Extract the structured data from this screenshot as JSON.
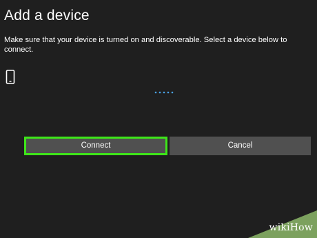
{
  "dialog": {
    "title": "Add a device",
    "description": "Make sure that your device is turned on and discoverable. Select a device below to connect.",
    "device_icon": "phone-icon",
    "spinner": "loading-dots"
  },
  "buttons": {
    "connect_label": "Connect",
    "cancel_label": "Cancel"
  },
  "watermark": {
    "text": "wikiHow"
  },
  "colors": {
    "background": "#1f1f1f",
    "button": "#505050",
    "highlight": "#3ee619",
    "spinner": "#4aa3e8"
  }
}
